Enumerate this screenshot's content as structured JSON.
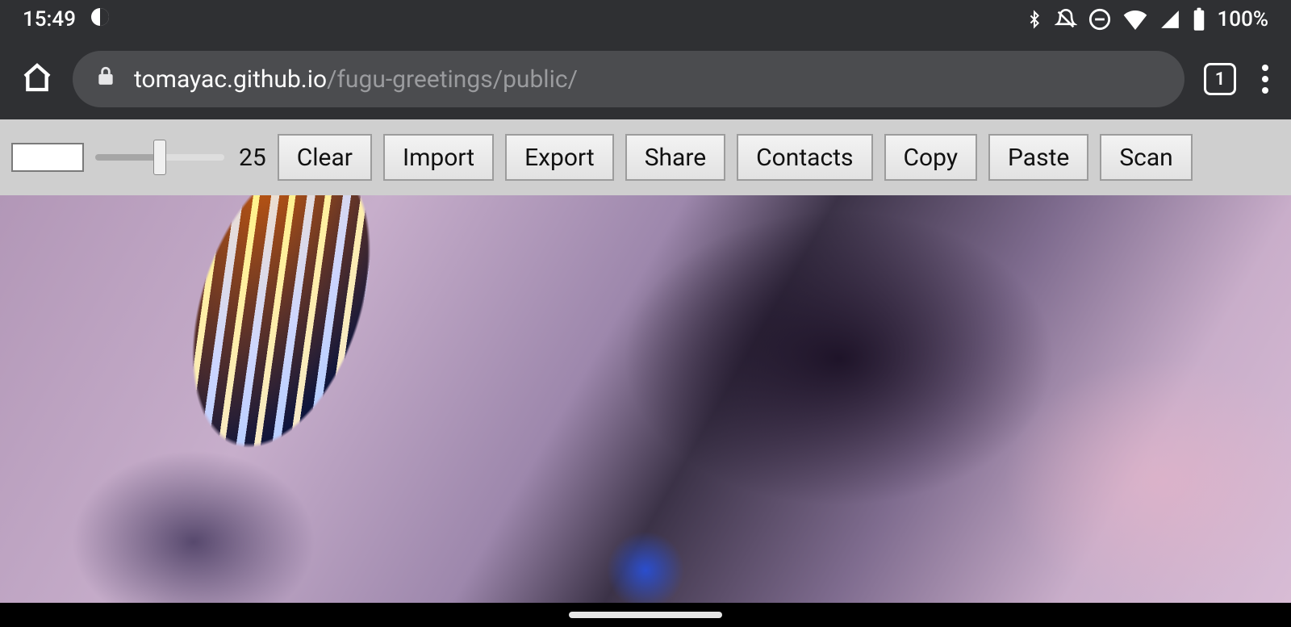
{
  "status": {
    "time": "15:49",
    "battery_text": "100%"
  },
  "address": {
    "url_domain": "tomayac.github.io",
    "url_path": "/fugu-greetings/public/",
    "tab_count": "1"
  },
  "toolbar": {
    "slider_value": "25",
    "buttons": {
      "clear": "Clear",
      "import": "Import",
      "export": "Export",
      "share": "Share",
      "contacts": "Contacts",
      "copy": "Copy",
      "paste": "Paste",
      "scan": "Scan"
    }
  }
}
